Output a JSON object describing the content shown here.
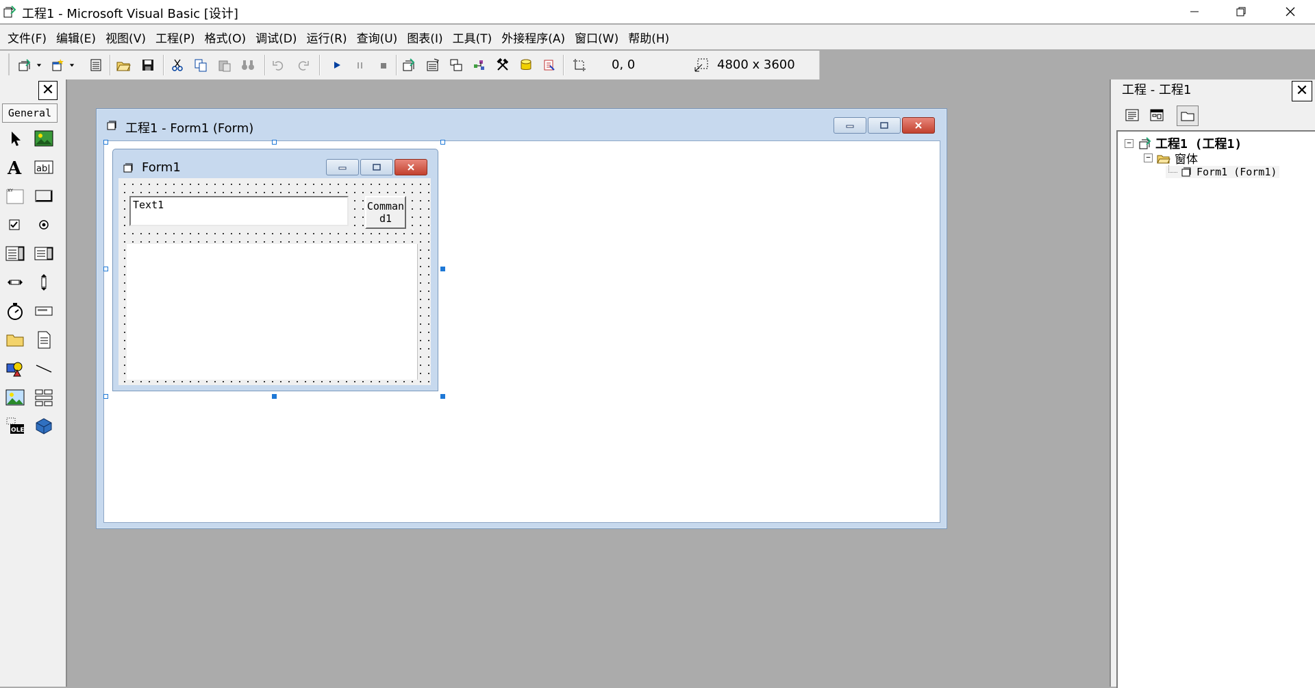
{
  "window": {
    "title": "工程1 - Microsoft Visual Basic [设计]",
    "minimize_icon": "minimize-icon",
    "restore_icon": "restore-icon",
    "close_icon": "close-icon"
  },
  "menu": [
    "文件(F)",
    "编辑(E)",
    "视图(V)",
    "工程(P)",
    "格式(O)",
    "调试(D)",
    "运行(R)",
    "查询(U)",
    "图表(I)",
    "工具(T)",
    "外接程序(A)",
    "窗口(W)",
    "帮助(H)"
  ],
  "toolbar": {
    "position": "0, 0",
    "size": "4800 x 3600"
  },
  "toolbox": {
    "tab_label": "General",
    "close_label": "✕",
    "tools": [
      "pointer",
      "picturebox",
      "label",
      "textbox",
      "frame",
      "commandbutton",
      "checkbox",
      "optionbutton",
      "combobox",
      "listbox",
      "hscrollbar",
      "vscrollbar",
      "timer",
      "drivelistbox",
      "dirlistbox",
      "filelistbox",
      "shape",
      "line",
      "image",
      "data",
      "ole",
      "extra"
    ]
  },
  "designer": {
    "title": "工程1 - Form1 (Form)",
    "form": {
      "title": "Form1",
      "textbox_text": "Text1",
      "command_caption": "Command1"
    }
  },
  "project": {
    "title": "工程 - 工程1",
    "close_label": "✕",
    "tree": {
      "root": "工程1 (工程1)",
      "folder": "窗体",
      "item": "Form1 (Form1)"
    }
  },
  "colors": {
    "mdi_background": "#ababab",
    "chrome": "#f0f0f0",
    "caption": "#c7d9ee",
    "selection_handle": "#1e78d6"
  }
}
